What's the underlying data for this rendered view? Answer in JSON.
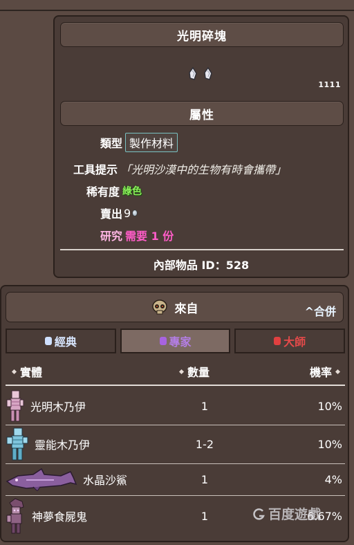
{
  "item": {
    "name": "光明碎塊",
    "stack_count": "1111",
    "section_title": "屬性",
    "type_label": "類型",
    "type_value": "製作材料",
    "tooltip_label": "工具提示",
    "tooltip_text": "「光明沙漠中的生物有時會攜帶」",
    "rarity_label": "稀有度",
    "rarity_value": "綠色",
    "sell_label": "賣出",
    "sell_value": "9",
    "research_label": "研究",
    "research_value": "需要 1 份",
    "id_text": "內部物品 ID：528"
  },
  "source": {
    "title": "來自",
    "collapse_label": "^合併",
    "tabs": [
      {
        "label": "經典",
        "active": false
      },
      {
        "label": "專家",
        "active": true
      },
      {
        "label": "大師",
        "active": false
      }
    ],
    "headers": {
      "npc": "實體",
      "qty": "數量",
      "rate": "機率"
    },
    "rows": [
      {
        "npc": "光明木乃伊",
        "qty": "1",
        "rate": "10%"
      },
      {
        "npc": "靈能木乃伊",
        "qty": "1-2",
        "rate": "10%"
      },
      {
        "npc": "水晶沙鯊",
        "qty": "1",
        "rate": "4%"
      },
      {
        "npc": "神夢食屍鬼",
        "qty": "1",
        "rate": "6.67%"
      }
    ]
  },
  "watermark": "百度遊戲",
  "colors": {
    "background": "#5b4a43",
    "panel": "#4a3c37",
    "rarity_green": "#8bf05a",
    "research_pink": "#ff5cc8",
    "expert_purple": "#b47ee6",
    "master_red": "#e54a4a"
  }
}
